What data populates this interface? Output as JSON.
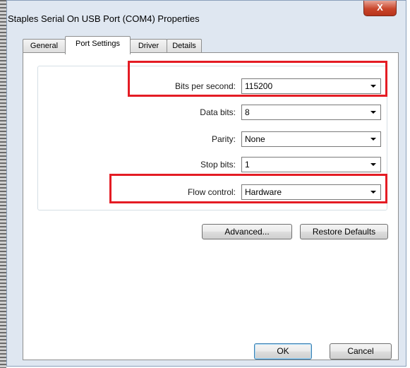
{
  "window": {
    "title": "Staples Serial On USB Port (COM4) Properties",
    "close_glyph": "X"
  },
  "tabs": [
    {
      "label": "General"
    },
    {
      "label": "Port Settings",
      "active": true
    },
    {
      "label": "Driver"
    },
    {
      "label": "Details"
    }
  ],
  "settings": {
    "bits_per_second": {
      "label": "Bits per second:",
      "value": "115200"
    },
    "data_bits": {
      "label": "Data bits:",
      "value": "8"
    },
    "parity": {
      "label": "Parity:",
      "value": "None"
    },
    "stop_bits": {
      "label": "Stop bits:",
      "value": "1"
    },
    "flow_control": {
      "label": "Flow control:",
      "value": "Hardware"
    }
  },
  "buttons": {
    "advanced": "Advanced...",
    "restore_defaults": "Restore Defaults",
    "ok": "OK",
    "cancel": "Cancel"
  },
  "highlight_color": "#e41c24"
}
